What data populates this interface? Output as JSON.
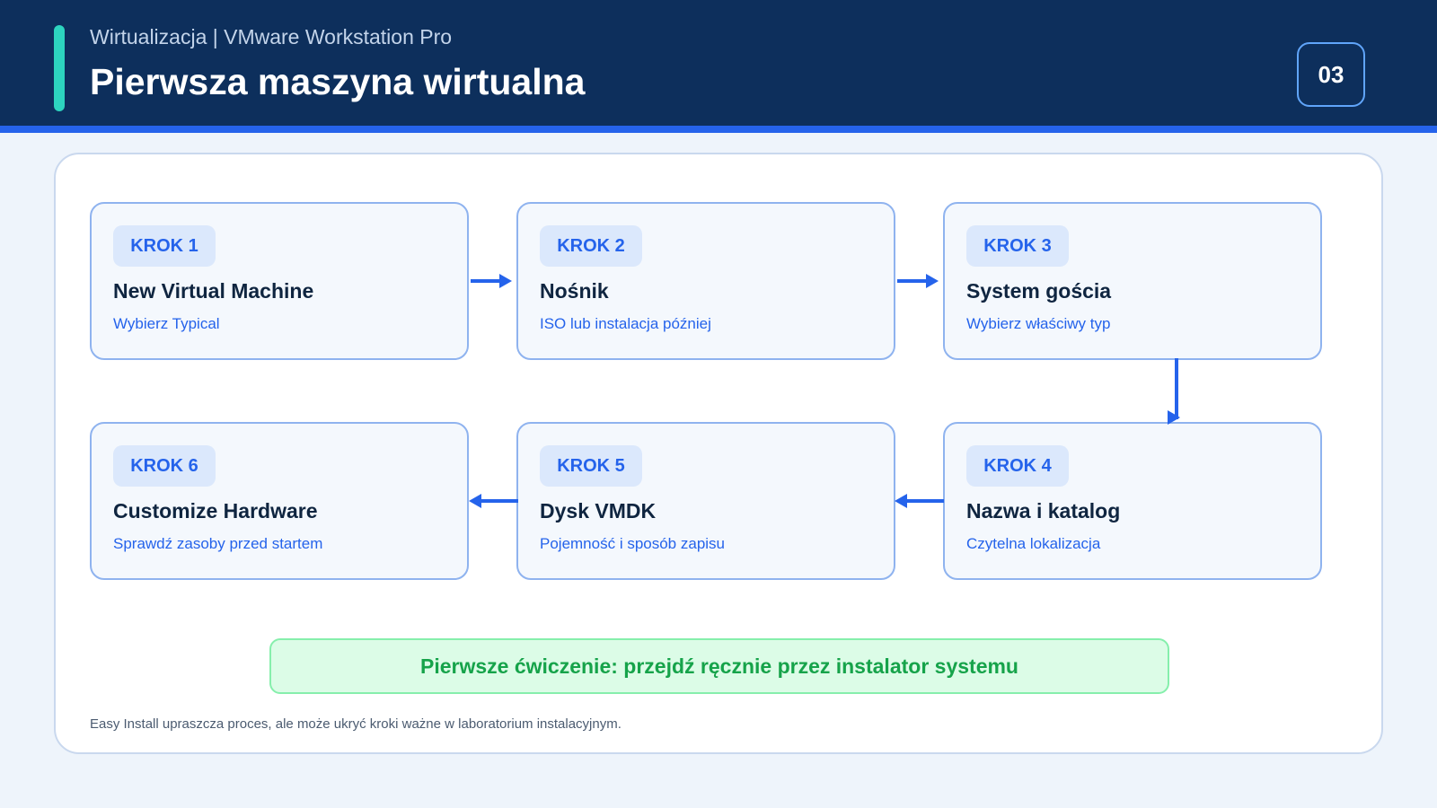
{
  "header": {
    "subtitle": "Wirtualizacja | VMware Workstation Pro",
    "title": "Pierwsza maszyna wirtualna",
    "page_number": "03"
  },
  "steps": [
    {
      "badge": "KROK 1",
      "title": "New Virtual Machine",
      "description": "Wybierz Typical"
    },
    {
      "badge": "KROK 2",
      "title": "Nośnik",
      "description": "ISO lub instalacja później"
    },
    {
      "badge": "KROK 3",
      "title": "System gościa",
      "description": "Wybierz właściwy typ"
    },
    {
      "badge": "KROK 4",
      "title": "Nazwa i katalog",
      "description": "Czytelna lokalizacja"
    },
    {
      "badge": "KROK 5",
      "title": "Dysk VMDK",
      "description": "Pojemność i sposób zapisu"
    },
    {
      "badge": "KROK 6",
      "title": "Customize Hardware",
      "description": "Sprawdź zasoby przed startem"
    }
  ],
  "callout": "Pierwsze ćwiczenie: przejdź ręcznie przez instalator systemu",
  "footnote": "Easy Install upraszcza proces, ale może ukryć kroki ważne w laboratorium instalacyjnym.",
  "colors": {
    "header_bg": "#0d2f5c",
    "accent": "#2dd4bf",
    "primary": "#2563eb",
    "success": "#16a34a"
  }
}
